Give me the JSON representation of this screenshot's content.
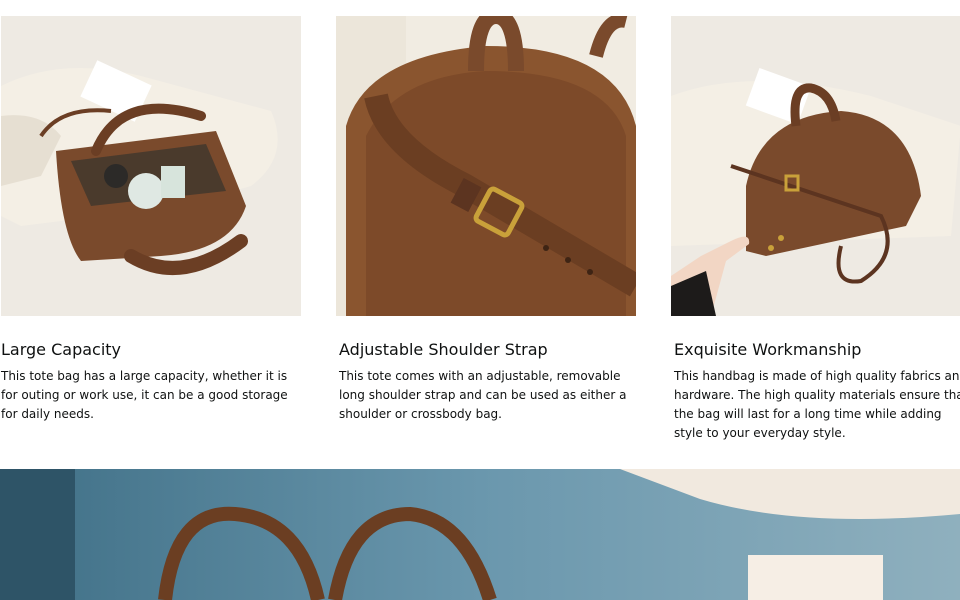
{
  "features": [
    {
      "title": "Large Capacity",
      "description": "This tote bag has a large capacity, whether it is for outing or work use, it can be a good storage for daily needs.",
      "image_label": "Brown suede tote bag shown open with items inside, on a cream jacket"
    },
    {
      "title": "Adjustable Shoulder Strap",
      "description": "This tote comes with an adjustable, removable long shoulder strap and can be used as either a shoulder or crossbody bag.",
      "image_label": "Close-up of brown suede bag with adjustable strap and gold buckle"
    },
    {
      "title": "Exquisite Workmanship",
      "description": "This handbag is made of high quality fabrics and hardware. The high quality materials ensure that the bag will last for a long time while adding style to your everyday style.",
      "image_label": "Hand holding brown suede dome handbag with long strap"
    }
  ],
  "banner": {
    "image_label": "Brown suede bag handles against a blue wall with a lamp"
  },
  "colors": {
    "suede": "#7a4a2c",
    "suede_dark": "#5c3420",
    "cream": "#f1ece2",
    "gold": "#c9a13a",
    "wall_blue": "#5f8fa8"
  }
}
